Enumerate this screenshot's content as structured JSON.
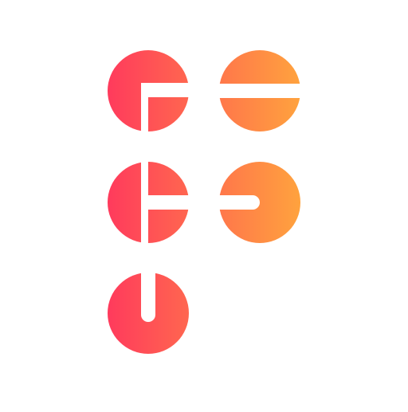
{
  "logo": {
    "icon_name": "dot-grid-letter-f-logo",
    "colors": {
      "background": "#ffffff",
      "gradient_start": "#ff3b5c",
      "gradient_end": "#ffa23e",
      "cut": "#ffffff"
    }
  }
}
